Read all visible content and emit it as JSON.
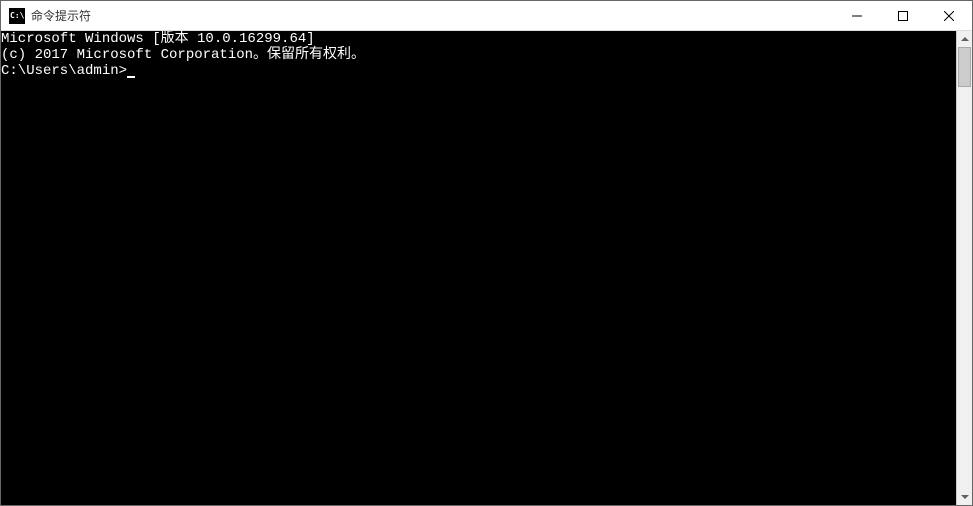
{
  "titlebar": {
    "icon_text": "C:\\.",
    "title": "命令提示符"
  },
  "terminal": {
    "line1": "Microsoft Windows [版本 10.0.16299.64]",
    "line2": "(c) 2017 Microsoft Corporation。保留所有权利。",
    "blank": "",
    "prompt": "C:\\Users\\admin>"
  }
}
